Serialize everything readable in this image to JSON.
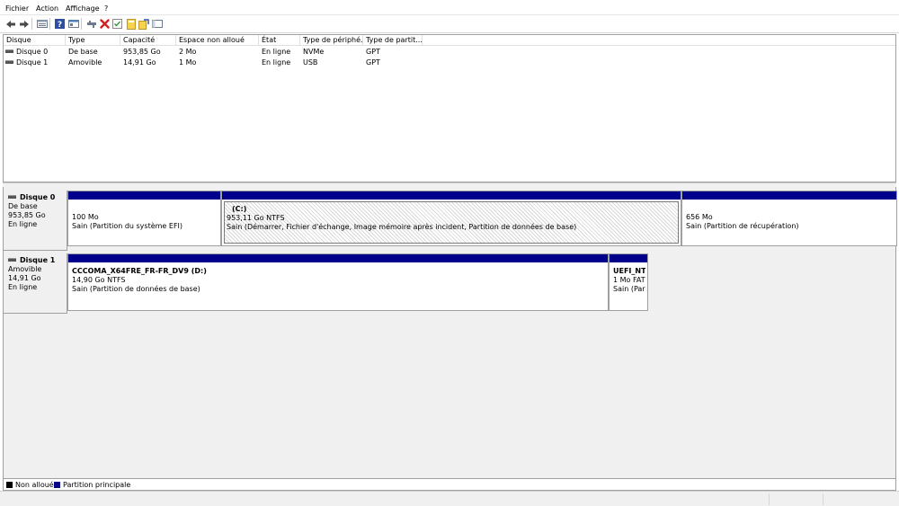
{
  "menu": {
    "file": "Fichier",
    "action": "Action",
    "view": "Affichage",
    "help": "?"
  },
  "toolbar": {
    "icons": [
      "back-icon",
      "forward-icon",
      "disk-list-icon",
      "help-icon",
      "properties-icon",
      "connect-icon",
      "delete-icon",
      "check-icon",
      "new-volume-icon",
      "wizard-icon",
      "console-icon"
    ]
  },
  "volume_list": {
    "headers": [
      "Disque",
      "Type",
      "Capacité",
      "Espace non alloué",
      "État",
      "Type de périphé...",
      "Type de partit..."
    ],
    "rows": [
      {
        "disk": "Disque 0",
        "type": "De base",
        "capacity": "953,85 Go",
        "unallocated": "2 Mo",
        "state": "En ligne",
        "device": "NVMe",
        "partition_type": "GPT"
      },
      {
        "disk": "Disque 1",
        "type": "Amovible",
        "capacity": "14,91 Go",
        "unallocated": "1 Mo",
        "state": "En ligne",
        "device": "USB",
        "partition_type": "GPT"
      }
    ]
  },
  "disks": [
    {
      "name": "Disque 0",
      "type": "De base",
      "size": "953,85 Go",
      "status": "En ligne",
      "partitions": [
        {
          "label": "",
          "size": "100 Mo",
          "status": "Sain (Partition du système EFI)"
        },
        {
          "label": "(C:)",
          "size": "953,11 Go NTFS",
          "status": "Sain (Démarrer, Fichier d'échange, Image mémoire après incident, Partition de données de base)"
        },
        {
          "label": "",
          "size": "656 Mo",
          "status": "Sain (Partition de récupération)"
        }
      ]
    },
    {
      "name": "Disque 1",
      "type": "Amovible",
      "size": "14,91 Go",
      "status": "En ligne",
      "partitions": [
        {
          "label": "CCCOMA_X64FRE_FR-FR_DV9  (D:)",
          "size": "14,90 Go NTFS",
          "status": "Sain (Partition de données de base)"
        },
        {
          "label": "UEFI_NTF",
          "size": "1 Mo FAT",
          "status": "Sain (Part"
        }
      ]
    }
  ],
  "legend": {
    "unallocated": "Non alloué",
    "primary": "Partition principale",
    "unallocated_color": "#000000",
    "primary_color": "#00008b"
  }
}
